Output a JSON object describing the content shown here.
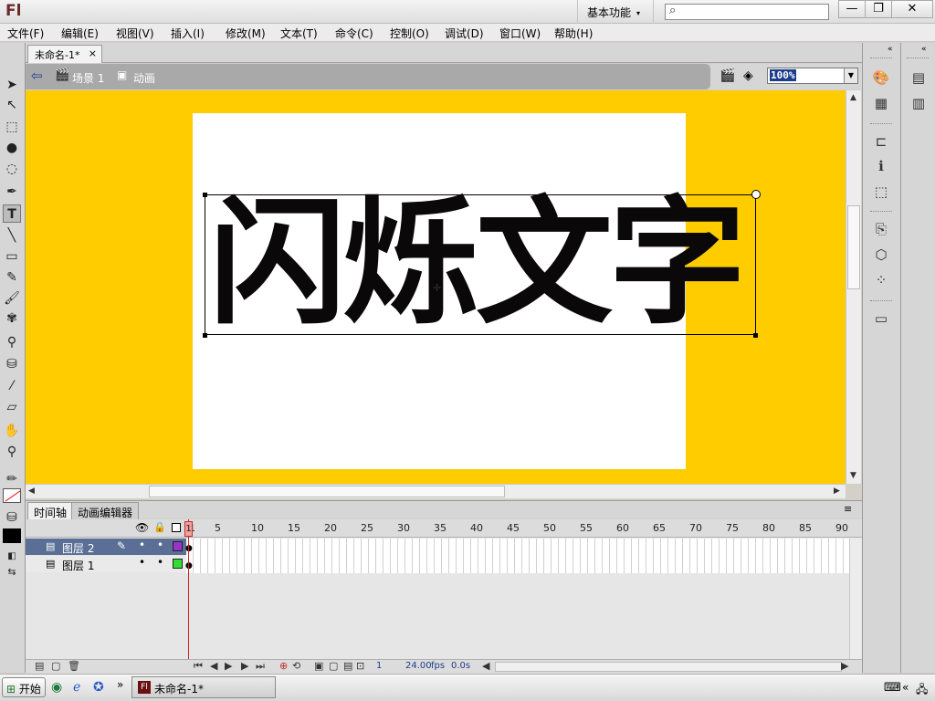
{
  "app": {
    "logo": "Fl",
    "workspace": "基本功能",
    "workspace_caret": "▾"
  },
  "window_controls": {
    "minimize": "—",
    "restore": "❐",
    "close": "✕"
  },
  "menu": [
    {
      "label": "文件(F)"
    },
    {
      "label": "编辑(E)"
    },
    {
      "label": "视图(V)"
    },
    {
      "label": "插入(I)"
    },
    {
      "label": "修改(M)"
    },
    {
      "label": "文本(T)"
    },
    {
      "label": "命令(C)"
    },
    {
      "label": "控制(O)"
    },
    {
      "label": "调试(D)"
    },
    {
      "label": "窗口(W)"
    },
    {
      "label": "帮助(H)"
    }
  ],
  "document_tab": {
    "title": "未命名-1*",
    "close": "×"
  },
  "editbar": {
    "back": "⇦",
    "scene_label": "场景 1",
    "symbol_label": "动画",
    "zoom": "100%"
  },
  "stage": {
    "text": "闪烁文字",
    "pasteboard_color": "#ffcc00"
  },
  "timeline": {
    "tabs": [
      "时间轴",
      "动画编辑器"
    ],
    "frame_numbers": [
      "1",
      "5",
      "10",
      "15",
      "20",
      "25",
      "30",
      "35",
      "40",
      "45",
      "50",
      "55",
      "60",
      "65",
      "70",
      "75",
      "80",
      "85",
      "90"
    ],
    "layers": [
      {
        "name": "图层 2",
        "selected": true,
        "outline_color": "#9933cc"
      },
      {
        "name": "图层 1",
        "selected": false,
        "outline_color": "#33dd33"
      }
    ],
    "footer": {
      "current_frame": "1",
      "fps": "24.00",
      "fps_unit": "fps",
      "time": "0.0s"
    }
  },
  "taskbar": {
    "start": "开始",
    "item": "未命名-1*",
    "item_icon": "Fl"
  }
}
